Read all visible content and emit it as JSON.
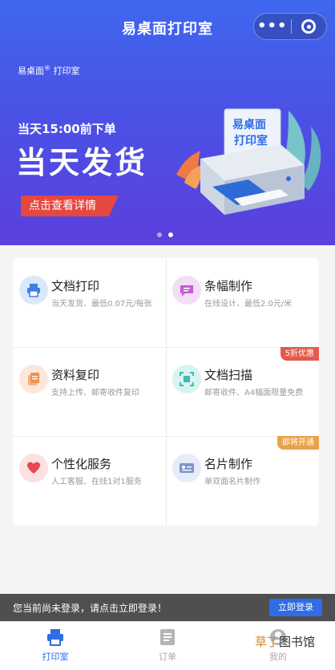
{
  "header": {
    "title": "易桌面打印室",
    "menu_icon": "more-dots-icon",
    "target_icon": "target-icon"
  },
  "banner": {
    "brand": "易桌面",
    "brand_reg": "®",
    "brand_suffix": "打印室",
    "deadline": "当天15:00前下单",
    "headline": "当天发货",
    "cta": "点击查看详情",
    "art_sign_line1": "易桌面",
    "art_sign_line2": "打印室",
    "colors": {
      "bg_top": "#3f67f0",
      "bg_bottom": "#5b3fdc",
      "cta": "#e4483f"
    }
  },
  "services": [
    {
      "title": "文档打印",
      "subtitle": "当天发货、最低0.07元/每张",
      "icon": "printer-icon",
      "icon_bg": "#dbe8fb",
      "icon_color": "#3f7fe0",
      "badge": ""
    },
    {
      "title": "条幅制作",
      "subtitle": "在线设计、最低2.0元/米",
      "icon": "banner-icon",
      "icon_bg": "#f4def7",
      "icon_color": "#c85ad8",
      "badge": ""
    },
    {
      "title": "资料复印",
      "subtitle": "支持上传、邮寄收件复印",
      "icon": "copy-icon",
      "icon_bg": "#fde7dc",
      "icon_color": "#f0904f",
      "badge": ""
    },
    {
      "title": "文档扫描",
      "subtitle": "邮寄收件、A4幅面限量免费",
      "icon": "scan-icon",
      "icon_bg": "#d9f3f1",
      "icon_color": "#3cbcb2",
      "badge": "5折优惠",
      "badge_color": "#e25b4c"
    },
    {
      "title": "个性化服务",
      "subtitle": "人工客服、在线1对1服务",
      "icon": "heart-icon",
      "icon_bg": "#fde1e1",
      "icon_color": "#e5484d",
      "badge": ""
    },
    {
      "title": "名片制作",
      "subtitle": "单双面名片制作",
      "icon": "card-icon",
      "icon_bg": "#e6ecf8",
      "icon_color": "#7c96c8",
      "badge": "即将开通",
      "badge_color": "#e8a24a"
    }
  ],
  "login_bar": {
    "text": "您当前尚未登录，请点击立即登录！",
    "button": "立即登录"
  },
  "tabbar": {
    "tabs": [
      {
        "label": "打印室",
        "icon": "printer-tab-icon",
        "active": true
      },
      {
        "label": "订单",
        "icon": "order-tab-icon",
        "active": false
      },
      {
        "label": "我的",
        "icon": "profile-tab-icon",
        "active": false
      }
    ],
    "active_color": "#2f6ce6",
    "inactive_color": "#aaaaaa"
  },
  "watermark": {
    "part_a": "草丁",
    "part_b": "图书馆"
  }
}
